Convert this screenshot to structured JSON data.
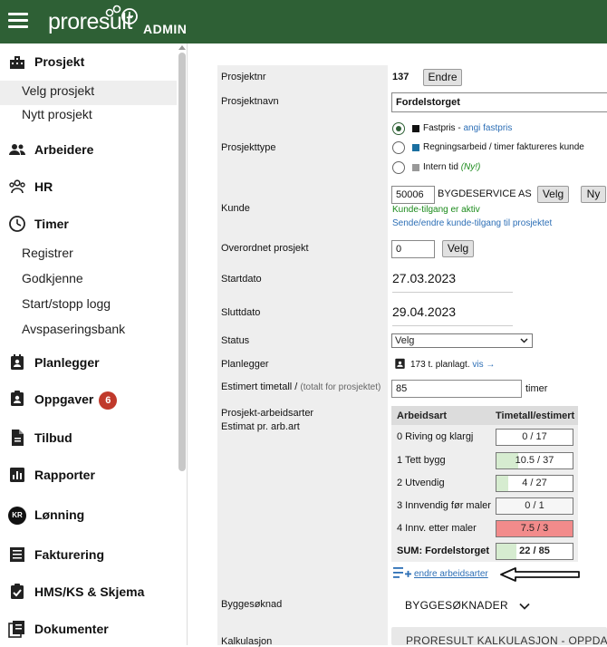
{
  "header": {
    "brand": "proresult",
    "admin_label": "ADMIN"
  },
  "sidebar": {
    "items": [
      {
        "label": "Prosjekt",
        "icon": "building-icon",
        "type": "main"
      },
      {
        "label": "Velg prosjekt",
        "type": "sub",
        "selected": true
      },
      {
        "label": "Nytt prosjekt",
        "type": "sub"
      },
      {
        "label": "Arbeidere",
        "icon": "people-icon",
        "type": "main"
      },
      {
        "label": "HR",
        "icon": "hr-group-icon",
        "type": "main"
      },
      {
        "label": "Timer",
        "icon": "clock-icon",
        "type": "main"
      },
      {
        "label": "Registrer",
        "type": "sub"
      },
      {
        "label": "Godkjenne",
        "type": "sub"
      },
      {
        "label": "Start/stopp logg",
        "type": "sub"
      },
      {
        "label": "Avspaseringsbank",
        "type": "sub"
      },
      {
        "label": "Planlegger",
        "icon": "contact-card-icon",
        "type": "main"
      },
      {
        "label": "Oppgaver",
        "icon": "task-icon",
        "type": "main",
        "badge": "6"
      },
      {
        "label": "Tilbud",
        "icon": "document-icon",
        "type": "main"
      },
      {
        "label": "Rapporter",
        "icon": "chart-icon",
        "type": "main"
      },
      {
        "label": "Lønning",
        "icon": "kr-icon",
        "icon_text": "KR",
        "type": "main"
      },
      {
        "label": "Fakturering",
        "icon": "invoice-icon",
        "type": "main"
      },
      {
        "label": "HMS/KS & Skjema",
        "icon": "checklist-icon",
        "type": "main"
      },
      {
        "label": "Dokumenter",
        "icon": "documents-icon",
        "type": "main"
      }
    ]
  },
  "form": {
    "prosjektnr": {
      "label": "Prosjektnr",
      "value": "137",
      "button": "Endre"
    },
    "prosjektnavn": {
      "label": "Prosjektnavn",
      "value": "Fordelstorget"
    },
    "prosjekttype": {
      "label": "Prosjekttype",
      "options": [
        {
          "text": "Fastpris",
          "sep": " - ",
          "link": "angi fastpris",
          "color": "#111111",
          "selected": true
        },
        {
          "text": "Regningsarbeid / timer faktureres kunde",
          "color": "#1a6fa0",
          "selected": false
        },
        {
          "text": "Intern tid",
          "extra": "(Ny!)",
          "color": "#999999",
          "selected": false
        }
      ]
    },
    "kunde": {
      "label": "Kunde",
      "number": "50006",
      "name": "BYGDESERVICE AS",
      "button_select": "Velg",
      "button_new": "Ny",
      "access_status": "Kunde-tilgang er aktiv",
      "access_link": "Sende/endre kunde-tilgang til prosjektet"
    },
    "overordnet": {
      "label": "Overordnet prosjekt",
      "value": "0",
      "button": "Velg"
    },
    "startdato": {
      "label": "Startdato",
      "value": "27.03.2023"
    },
    "sluttdato": {
      "label": "Sluttdato",
      "value": "29.04.2023"
    },
    "status": {
      "label": "Status",
      "selected": "Velg"
    },
    "planlegger": {
      "label": "Planlegger",
      "value": "173 t. planlagt.",
      "link": "vis →"
    },
    "estimert": {
      "label": "Estimert timetall /",
      "hint": "(totalt for prosjektet)",
      "value": "85",
      "unit": "timer"
    },
    "arbeidsarter": {
      "label": "Prosjekt-arbeidsarter",
      "sublabel": "Estimat pr. arb.art",
      "col_name": "Arbeidsart",
      "col_value": "Timetall/estimert",
      "rows": [
        {
          "name": "0 Riving og klargj",
          "value": "0 / 17",
          "fraction": 0,
          "color": "#ffffff"
        },
        {
          "name": "1 Tett bygg",
          "value": "10.5 / 37",
          "fraction": 0.28,
          "color": "#d6ecd0"
        },
        {
          "name": "2 Utvendig",
          "value": "4 / 27",
          "fraction": 0.15,
          "color": "#d6ecd0"
        },
        {
          "name": "3 Innvendig før maler",
          "value": "0 / 1",
          "fraction": 0,
          "color": "#ffffff"
        },
        {
          "name": "4 Innv. etter maler",
          "value": "7.5 / 3",
          "fraction": 1,
          "color": "#f28b8b"
        }
      ],
      "sum_name": "SUM: Fordelstorget",
      "sum_value": "22 / 85",
      "sum_fraction": 0.26,
      "edit_link": "endre arbeidsarter"
    },
    "byggesoknad": {
      "label": "Byggesøknad",
      "dropdown": "BYGGESØKNADER"
    },
    "kalkulasjon": {
      "label": "Kalkulasjon",
      "button": "PRORESULT KALKULASJON - OPPDA"
    }
  }
}
